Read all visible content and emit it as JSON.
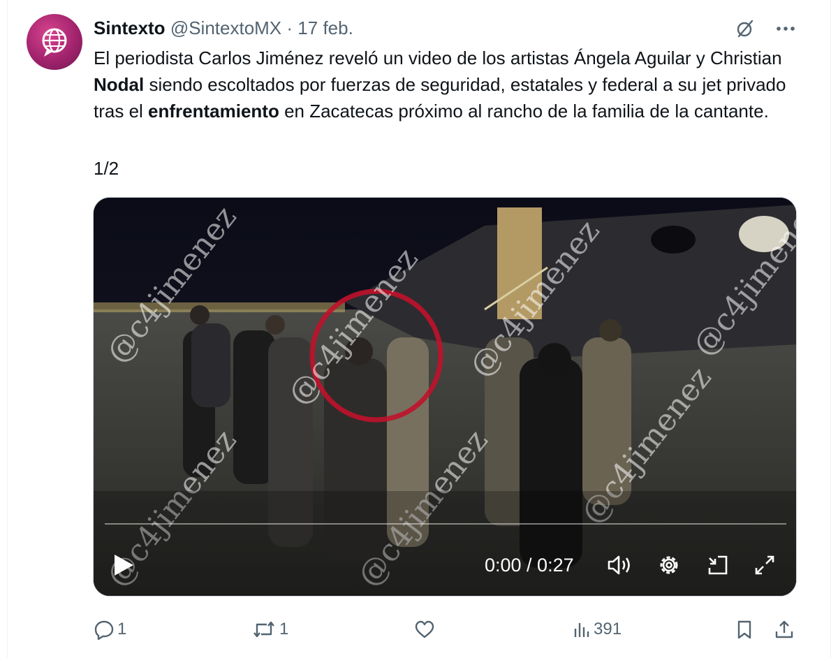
{
  "tweet": {
    "author_name": "Sintexto",
    "handle": "@SintextoMX",
    "separator": "·",
    "date": "17 feb.",
    "text_parts": {
      "p1": "El periodista Carlos Jiménez reveló un video de los artistas Ángela Aguilar y Christian ",
      "b1": "Nodal",
      "p2": " siendo escoltados por fuerzas de seguridad, estatales y federal a su jet privado tras el ",
      "b2": "enfrentamiento",
      "p3": " en Zacatecas próximo al rancho de la familia de la cantante."
    },
    "thread_counter": "1/2"
  },
  "video": {
    "time_display": "0:00 / 0:27",
    "watermark": "@c4jimenez",
    "progress": 0.0
  },
  "actions": {
    "replies": "1",
    "reposts": "1",
    "likes": "",
    "views": "391"
  },
  "icons": {
    "header": [
      "grok-icon",
      "more-icon"
    ],
    "video": [
      "play-icon",
      "volume-icon",
      "settings-gear-icon",
      "picture-in-picture-icon",
      "fullscreen-icon"
    ],
    "actions": [
      "reply-icon",
      "repost-icon",
      "like-icon",
      "views-icon",
      "bookmark-icon",
      "share-icon"
    ]
  },
  "colors": {
    "text": "#0f1419",
    "muted": "#536471",
    "avatar": "#a2236d",
    "highlight_circle": "#c0122b"
  }
}
